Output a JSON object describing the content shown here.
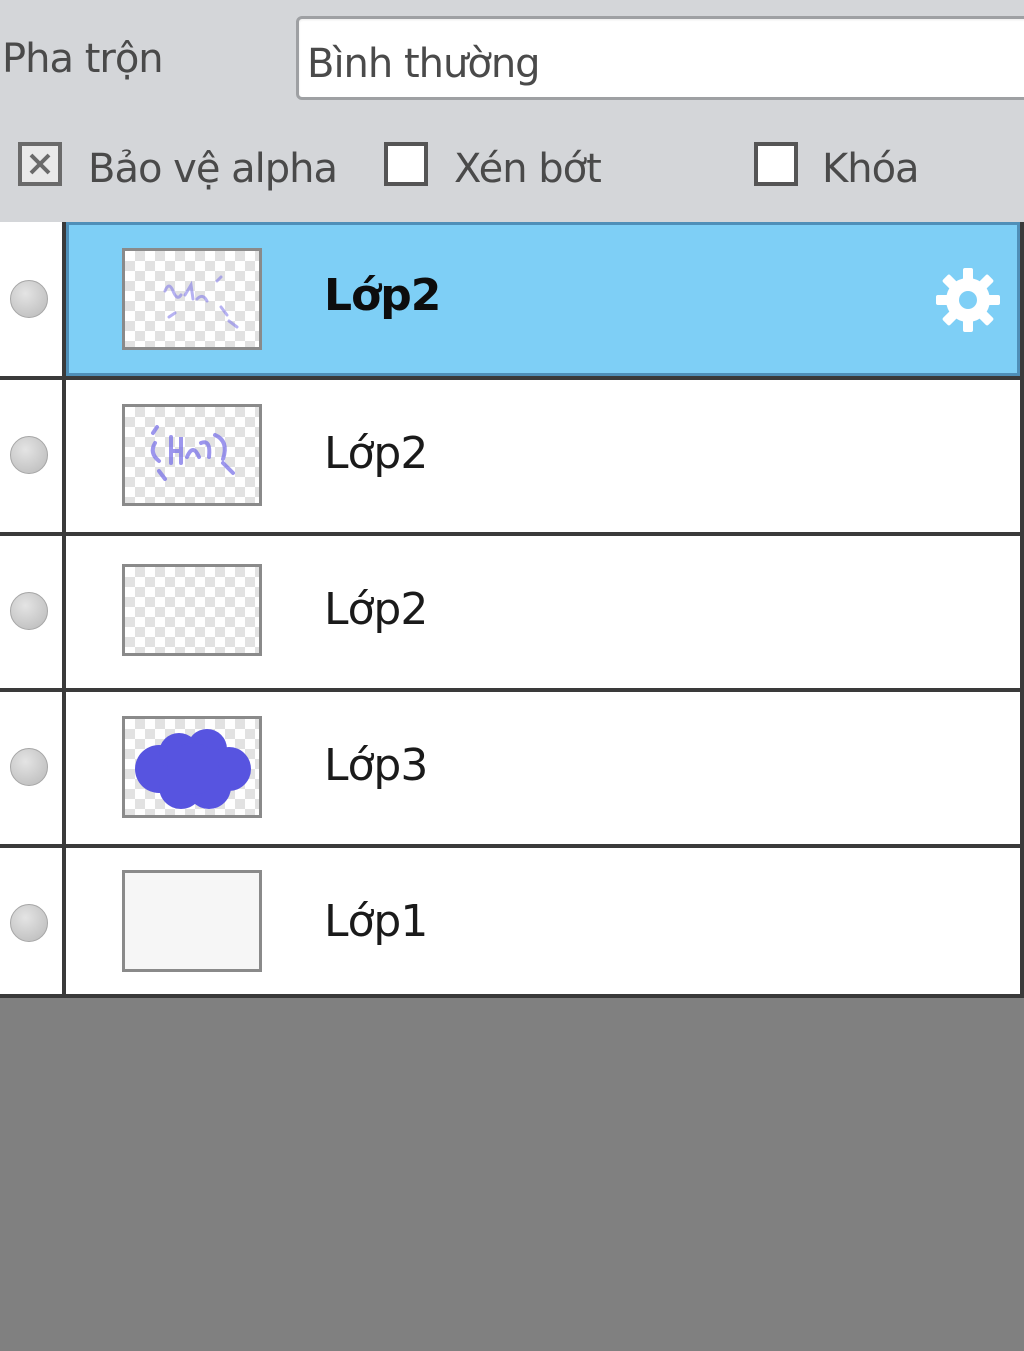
{
  "blend": {
    "label": "Pha trộn",
    "value": "Bình thường"
  },
  "options": [
    {
      "label": "Bảo vệ alpha",
      "checked": true
    },
    {
      "label": "Xén bớt",
      "checked": false
    },
    {
      "label": "Khóa",
      "checked": false
    }
  ],
  "layers": [
    {
      "name": "Lớp2",
      "selected": true,
      "thumbnail": "sparse-purple-scribble",
      "icon": "gear-icon"
    },
    {
      "name": "Lớp2",
      "selected": false,
      "thumbnail": "purple-scribble"
    },
    {
      "name": "Lớp2",
      "selected": false,
      "thumbnail": "empty-transparent"
    },
    {
      "name": "Lớp3",
      "selected": false,
      "thumbnail": "blue-blob"
    },
    {
      "name": "Lớp1",
      "selected": false,
      "thumbnail": "white-fill"
    }
  ],
  "colors": {
    "selected_row": "#7ecff6",
    "blob": "#5754e0",
    "scribble": "#7b74e8"
  }
}
